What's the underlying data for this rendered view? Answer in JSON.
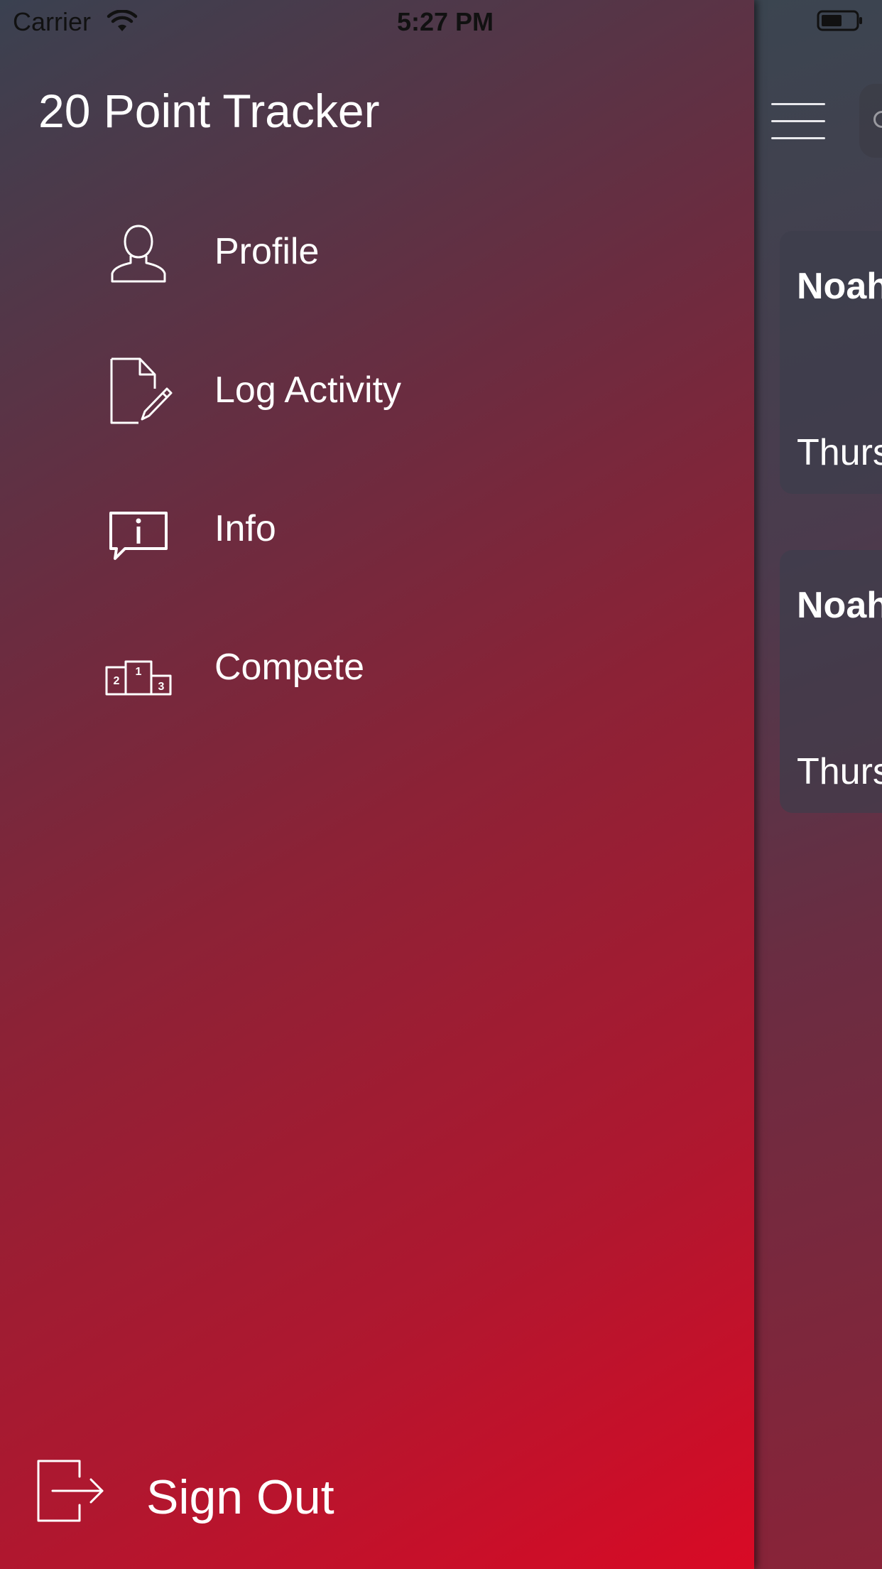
{
  "status_bar": {
    "carrier": "Carrier",
    "time": "5:27 PM",
    "wifi_icon": "wifi-icon",
    "battery_icon": "battery-icon"
  },
  "menu": {
    "title": "20 Point Tracker",
    "items": [
      {
        "label": "Profile",
        "icon": "person-icon"
      },
      {
        "label": "Log Activity",
        "icon": "document-edit-icon"
      },
      {
        "label": "Info",
        "icon": "info-bubble-icon"
      },
      {
        "label": "Compete",
        "icon": "podium-icon"
      }
    ],
    "sign_out": {
      "label": "Sign Out",
      "icon": "sign-out-icon"
    }
  },
  "main": {
    "menu_icon": "hamburger-icon",
    "search_icon": "search-icon",
    "cards": [
      {
        "name": "Noah",
        "day": "Thurs"
      },
      {
        "name": "Noah",
        "day": "Thurs"
      }
    ]
  },
  "colors": {
    "drawer_gradient_start": "#3a4150",
    "drawer_gradient_mid": "#8c2236",
    "drawer_gradient_end": "#d90a25",
    "text": "#ffffff"
  }
}
